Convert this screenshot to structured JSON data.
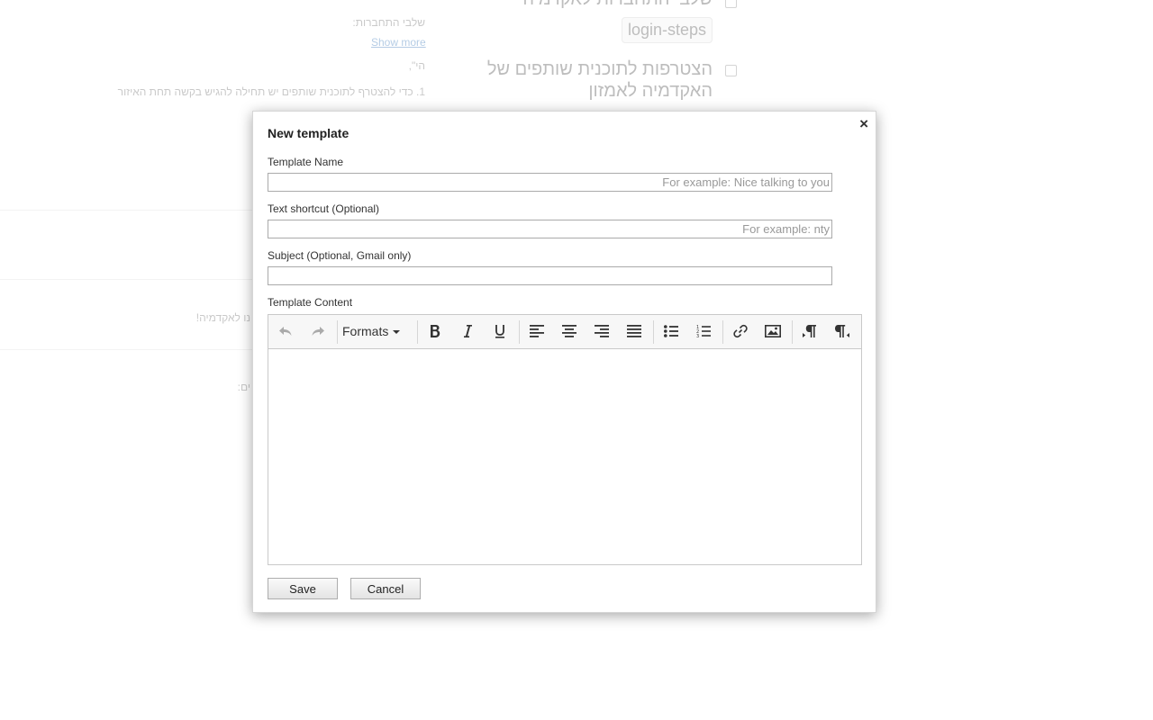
{
  "background": {
    "heading1": "שלבי התחברות לאקדמיה",
    "chip1": "login-steps",
    "label_steps": "שלבי התחברות:",
    "show_more": "Show more",
    "text_hi": "הי\",",
    "text_line1": "1. כדי להצטרף לתוכנית שותפים יש תחילה להגיש בקשה תחת האיזור",
    "heading2_line1": "הצטרפות לתוכנית שותפים של",
    "heading2_line2": "האקדמיה לאמזון",
    "text_welcome": "נו לאקדמיה!",
    "text_colon": "ים:"
  },
  "modal": {
    "title": "New template",
    "close_label": "×",
    "template_name": {
      "label": "Template Name",
      "placeholder": "For example: Nice talking to you",
      "value": ""
    },
    "shortcut": {
      "label": "Text shortcut (Optional)",
      "placeholder": "For example: nty",
      "value": ""
    },
    "subject": {
      "label": "Subject (Optional, Gmail only)",
      "placeholder": "",
      "value": ""
    },
    "content": {
      "label": "Template Content"
    },
    "toolbar": {
      "formats_label": "Formats",
      "icons": [
        "undo-icon",
        "redo-icon",
        "bold-icon",
        "italic-icon",
        "underline-icon",
        "align-left-icon",
        "align-center-icon",
        "align-right-icon",
        "justify-icon",
        "bullet-list-icon",
        "numbered-list-icon",
        "link-icon",
        "image-icon",
        "ltr-icon",
        "rtl-icon"
      ]
    },
    "save_label": "Save",
    "cancel_label": "Cancel"
  }
}
